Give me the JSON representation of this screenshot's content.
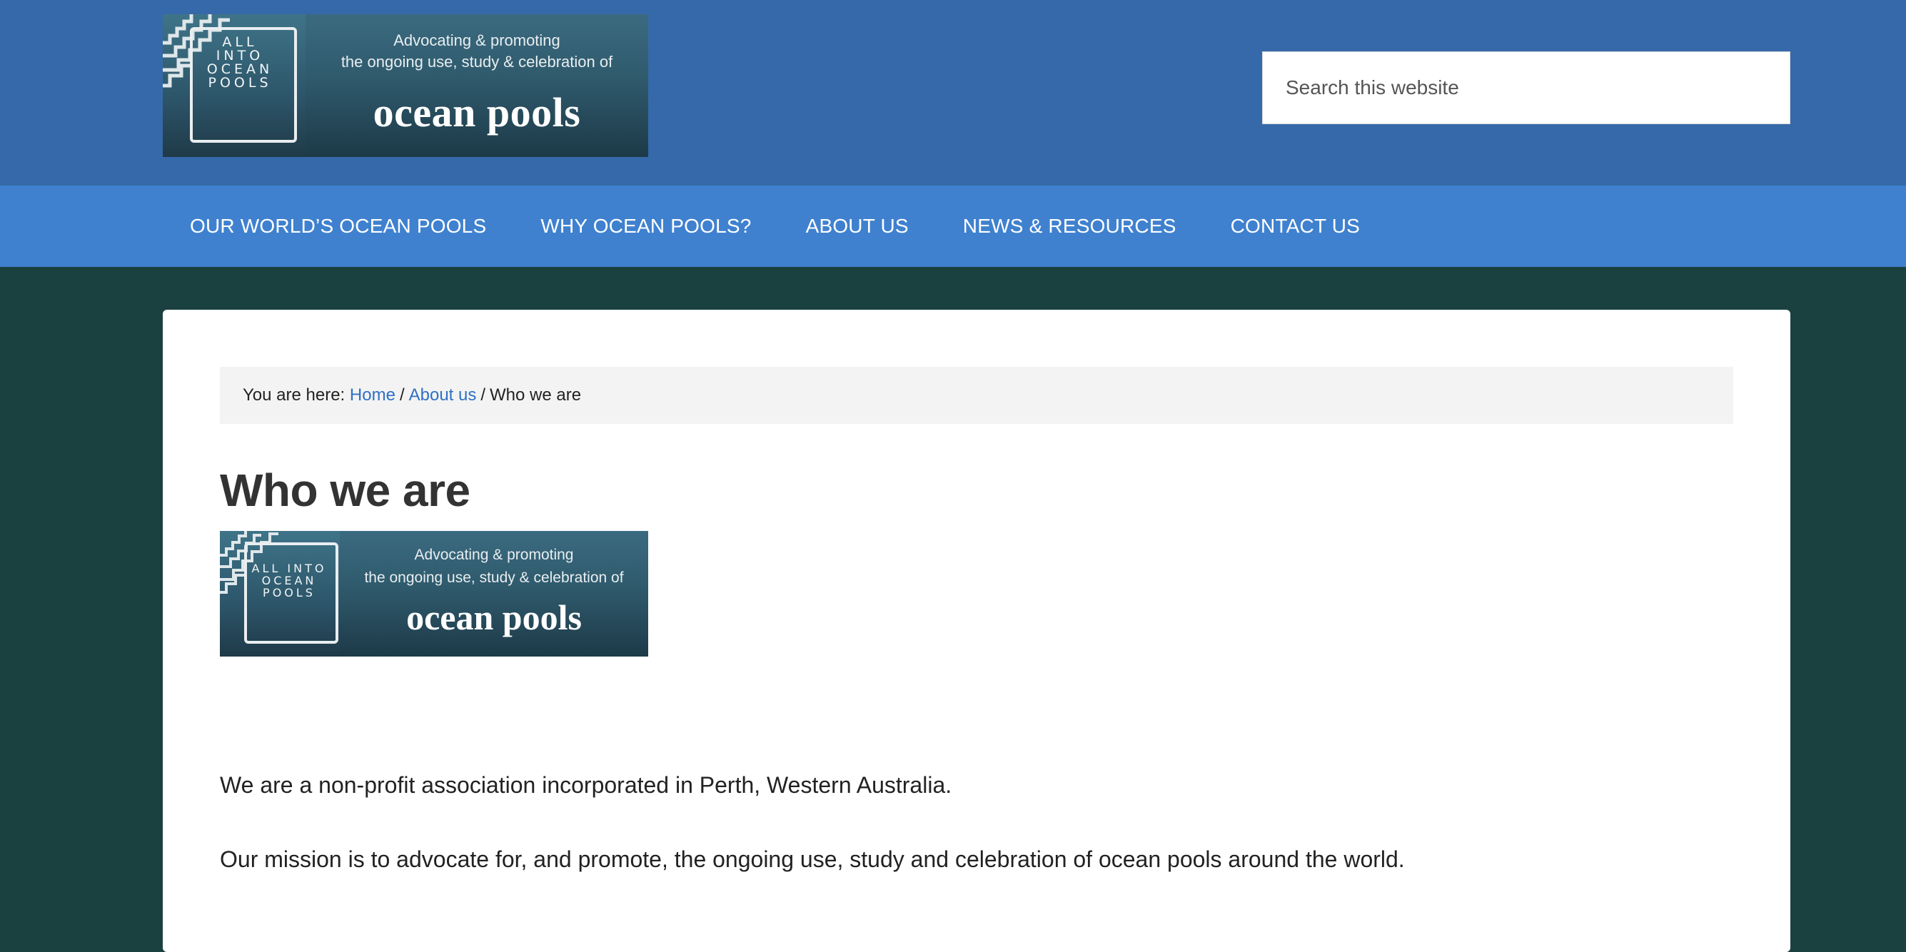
{
  "header": {
    "logo": {
      "box_text": "ALL INTO OCEAN POOLS",
      "tagline_line1": "Advocating & promoting",
      "tagline_line2": "the ongoing use, study & celebration of",
      "name": "ocean pools"
    },
    "search": {
      "placeholder": "Search this website"
    }
  },
  "nav": {
    "items": [
      {
        "label": "OUR WORLD’S OCEAN POOLS"
      },
      {
        "label": "WHY OCEAN POOLS?"
      },
      {
        "label": "ABOUT US"
      },
      {
        "label": "NEWS & RESOURCES"
      },
      {
        "label": "CONTACT US"
      }
    ]
  },
  "breadcrumb": {
    "prefix": "You are here:",
    "items": [
      {
        "label": "Home"
      },
      {
        "label": "About us"
      },
      {
        "label": "Who we are"
      }
    ],
    "separator": "/"
  },
  "page": {
    "title": "Who we are",
    "image": {
      "box_text": "ALL INTO OCEAN POOLS",
      "tagline_line1": "Advocating & promoting",
      "tagline_line2": "the ongoing use, study & celebration of",
      "name": "ocean pools"
    },
    "paragraphs": [
      "We are a non-profit association incorporated in Perth, Western Australia.",
      "Our mission is to advocate for, and promote, the ongoing use, study and celebration of ocean pools around the world."
    ]
  },
  "colors": {
    "header_bg": "#3669aa",
    "nav_bg": "#3f81cf",
    "page_bg": "#1b4040",
    "link": "#2f71c4"
  }
}
